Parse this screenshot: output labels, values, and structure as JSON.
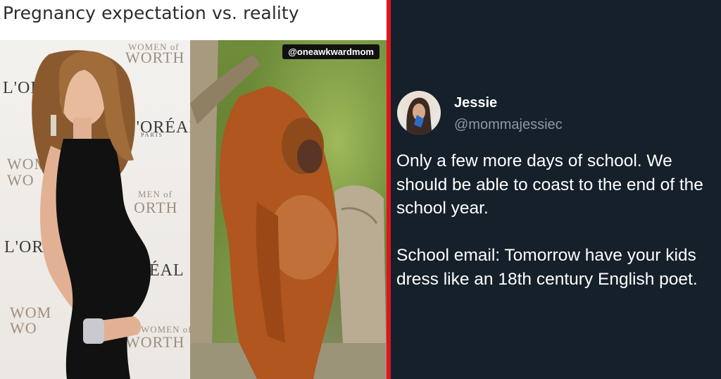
{
  "meme": {
    "caption": "Pregnancy expectation vs. reality",
    "watermark": "@oneawkwardmom",
    "backdrop": {
      "loreal": "L'ORÉAL",
      "loreal_short": "L'OR",
      "paris": "PARIS",
      "women_of_worth_1": "WOMEN of",
      "women_of_worth_2": "WORTH",
      "wow_frag_1": "WOM",
      "wow_frag_2": "WO",
      "men_of": "MEN of",
      "orth": "ORTH",
      "eal": "ÉAL"
    }
  },
  "tweet": {
    "display_name": "Jessie",
    "handle": "@mommajessiec",
    "paragraph_1": "Only a few more days of school. We should be able to coast to the end of the school year.",
    "paragraph_2": "School email: Tomorrow have your kids dress like an 18th century English poet."
  },
  "colors": {
    "divider": "#e0141e",
    "tweet_background": "#15202b",
    "handle_text": "#8b98a5"
  }
}
